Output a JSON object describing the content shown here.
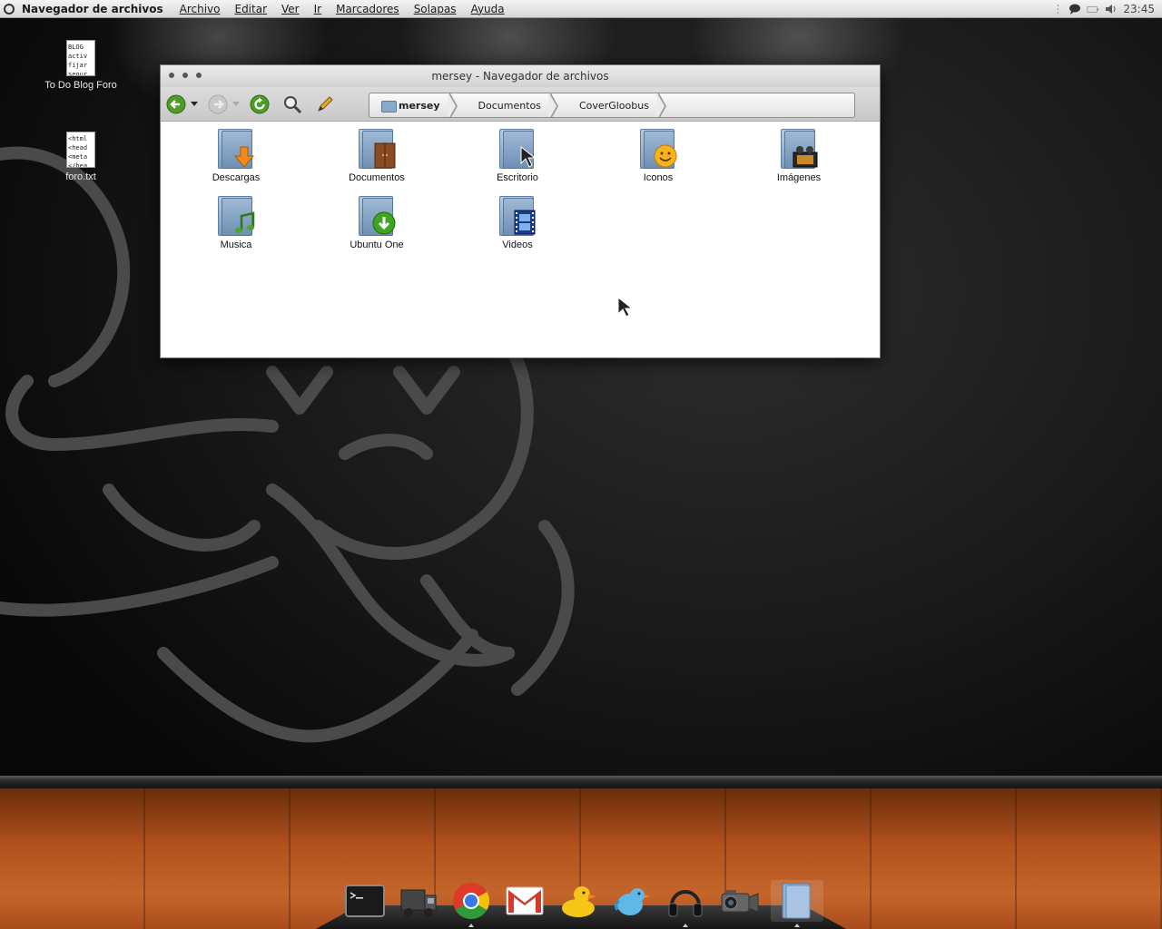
{
  "topbar": {
    "app_name": "Navegador de archivos",
    "menus": [
      "Archivo",
      "Editar",
      "Ver",
      "Ir",
      "Marcadores",
      "Solapas",
      "Ayuda"
    ],
    "clock": "23:45",
    "tray_icons": [
      "chat-icon",
      "battery-icon",
      "volume-icon"
    ]
  },
  "desktop": {
    "icons": [
      {
        "label": "To Do Blog Foro",
        "preview": "BLOG\nactiv\nfijar\nseour"
      },
      {
        "label": "foro.txt",
        "preview": "<html\n<head\n<meta\n</hea"
      }
    ]
  },
  "window": {
    "title": "mersey - Navegador de archivos",
    "breadcrumbs": [
      "mersey",
      "Documentos",
      "CoverGloobus"
    ],
    "folders": [
      {
        "label": "Descargas",
        "emblem": "download-arrow-icon"
      },
      {
        "label": "Documentos",
        "emblem": "wardrobe-icon"
      },
      {
        "label": "Escritorio",
        "emblem": "cursor-icon"
      },
      {
        "label": "Iconos",
        "emblem": "smiley-icon"
      },
      {
        "label": "Imágenes",
        "emblem": "film-camera-icon"
      },
      {
        "label": "Musica",
        "emblem": "music-note-icon"
      },
      {
        "label": "Ubuntu One",
        "emblem": "green-download-icon"
      },
      {
        "label": "Videos",
        "emblem": "filmstrip-icon"
      }
    ]
  },
  "dock": {
    "items": [
      "terminal-icon",
      "truck-icon",
      "chrome-icon",
      "gmail-icon",
      "duck-icon",
      "twitter-bird-icon",
      "headphones-icon",
      "camcorder-icon",
      "folder-icon"
    ]
  }
}
